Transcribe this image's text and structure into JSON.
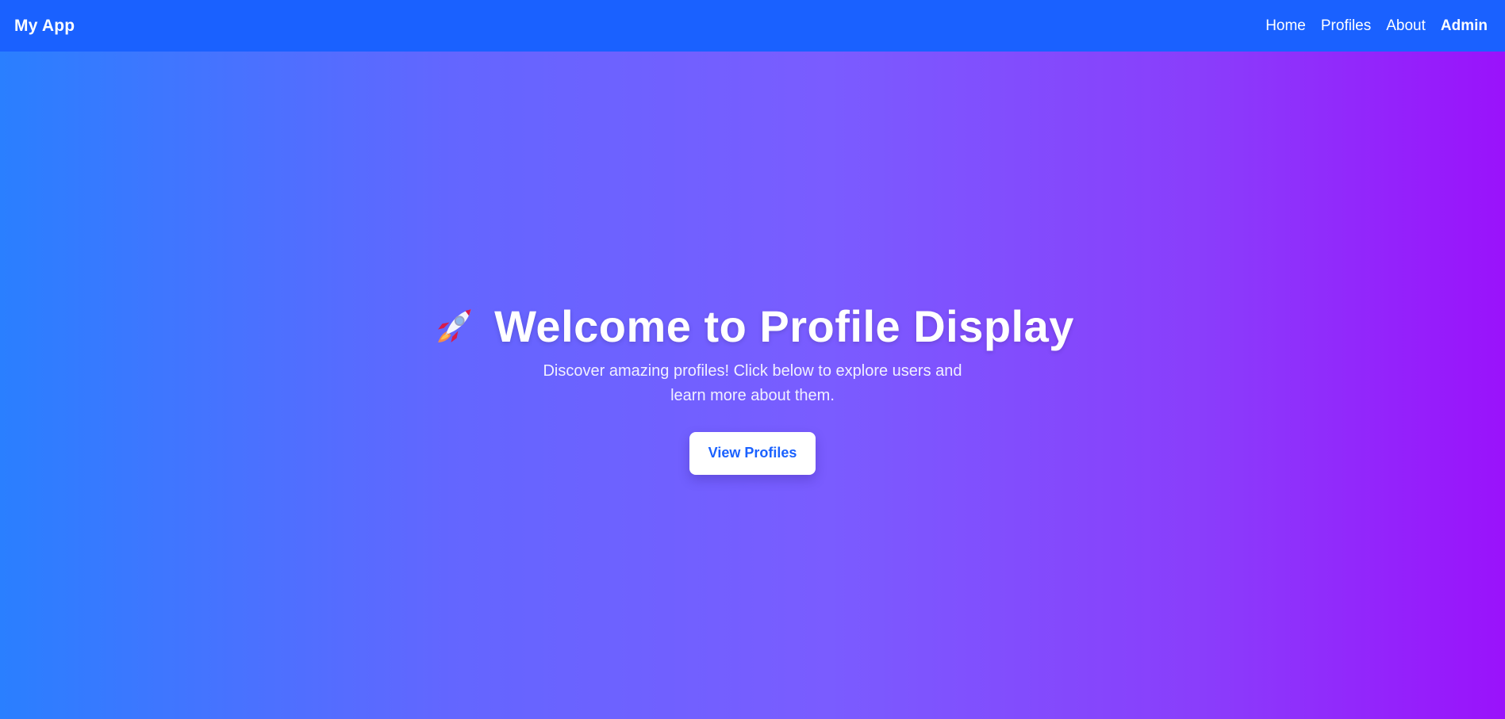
{
  "navbar": {
    "brand": "My App",
    "links": [
      {
        "label": "Home"
      },
      {
        "label": "Profiles"
      },
      {
        "label": "About"
      },
      {
        "label": "Admin"
      }
    ]
  },
  "hero": {
    "icon": "rocket-icon",
    "title": "Welcome to Profile Display",
    "subtitle": "Discover amazing profiles! Click below to explore users and learn more about them.",
    "cta_label": "View Profiles"
  },
  "colors": {
    "navbar_bg": "#1a61ff",
    "gradient_start": "#2a7fff",
    "gradient_end": "#9a12fb",
    "button_text": "#1a61ff",
    "text": "#ffffff"
  }
}
